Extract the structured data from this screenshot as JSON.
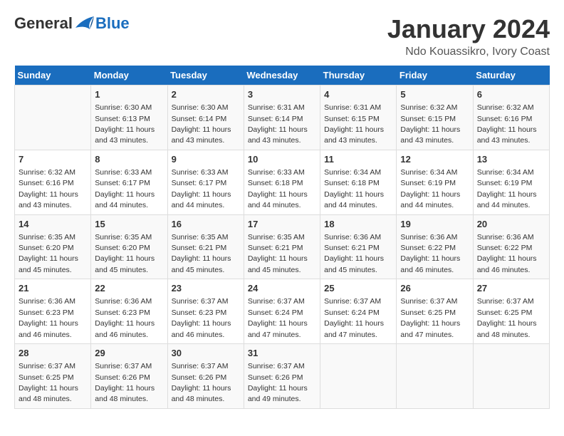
{
  "header": {
    "logo_general": "General",
    "logo_blue": "Blue",
    "title": "January 2024",
    "location": "Ndo Kouassikro, Ivory Coast"
  },
  "days_of_week": [
    "Sunday",
    "Monday",
    "Tuesday",
    "Wednesday",
    "Thursday",
    "Friday",
    "Saturday"
  ],
  "weeks": [
    [
      {
        "day": "",
        "info": ""
      },
      {
        "day": "1",
        "info": "Sunrise: 6:30 AM\nSunset: 6:13 PM\nDaylight: 11 hours\nand 43 minutes."
      },
      {
        "day": "2",
        "info": "Sunrise: 6:30 AM\nSunset: 6:14 PM\nDaylight: 11 hours\nand 43 minutes."
      },
      {
        "day": "3",
        "info": "Sunrise: 6:31 AM\nSunset: 6:14 PM\nDaylight: 11 hours\nand 43 minutes."
      },
      {
        "day": "4",
        "info": "Sunrise: 6:31 AM\nSunset: 6:15 PM\nDaylight: 11 hours\nand 43 minutes."
      },
      {
        "day": "5",
        "info": "Sunrise: 6:32 AM\nSunset: 6:15 PM\nDaylight: 11 hours\nand 43 minutes."
      },
      {
        "day": "6",
        "info": "Sunrise: 6:32 AM\nSunset: 6:16 PM\nDaylight: 11 hours\nand 43 minutes."
      }
    ],
    [
      {
        "day": "7",
        "info": "Sunrise: 6:32 AM\nSunset: 6:16 PM\nDaylight: 11 hours\nand 43 minutes."
      },
      {
        "day": "8",
        "info": "Sunrise: 6:33 AM\nSunset: 6:17 PM\nDaylight: 11 hours\nand 44 minutes."
      },
      {
        "day": "9",
        "info": "Sunrise: 6:33 AM\nSunset: 6:17 PM\nDaylight: 11 hours\nand 44 minutes."
      },
      {
        "day": "10",
        "info": "Sunrise: 6:33 AM\nSunset: 6:18 PM\nDaylight: 11 hours\nand 44 minutes."
      },
      {
        "day": "11",
        "info": "Sunrise: 6:34 AM\nSunset: 6:18 PM\nDaylight: 11 hours\nand 44 minutes."
      },
      {
        "day": "12",
        "info": "Sunrise: 6:34 AM\nSunset: 6:19 PM\nDaylight: 11 hours\nand 44 minutes."
      },
      {
        "day": "13",
        "info": "Sunrise: 6:34 AM\nSunset: 6:19 PM\nDaylight: 11 hours\nand 44 minutes."
      }
    ],
    [
      {
        "day": "14",
        "info": "Sunrise: 6:35 AM\nSunset: 6:20 PM\nDaylight: 11 hours\nand 45 minutes."
      },
      {
        "day": "15",
        "info": "Sunrise: 6:35 AM\nSunset: 6:20 PM\nDaylight: 11 hours\nand 45 minutes."
      },
      {
        "day": "16",
        "info": "Sunrise: 6:35 AM\nSunset: 6:21 PM\nDaylight: 11 hours\nand 45 minutes."
      },
      {
        "day": "17",
        "info": "Sunrise: 6:35 AM\nSunset: 6:21 PM\nDaylight: 11 hours\nand 45 minutes."
      },
      {
        "day": "18",
        "info": "Sunrise: 6:36 AM\nSunset: 6:21 PM\nDaylight: 11 hours\nand 45 minutes."
      },
      {
        "day": "19",
        "info": "Sunrise: 6:36 AM\nSunset: 6:22 PM\nDaylight: 11 hours\nand 46 minutes."
      },
      {
        "day": "20",
        "info": "Sunrise: 6:36 AM\nSunset: 6:22 PM\nDaylight: 11 hours\nand 46 minutes."
      }
    ],
    [
      {
        "day": "21",
        "info": "Sunrise: 6:36 AM\nSunset: 6:23 PM\nDaylight: 11 hours\nand 46 minutes."
      },
      {
        "day": "22",
        "info": "Sunrise: 6:36 AM\nSunset: 6:23 PM\nDaylight: 11 hours\nand 46 minutes."
      },
      {
        "day": "23",
        "info": "Sunrise: 6:37 AM\nSunset: 6:23 PM\nDaylight: 11 hours\nand 46 minutes."
      },
      {
        "day": "24",
        "info": "Sunrise: 6:37 AM\nSunset: 6:24 PM\nDaylight: 11 hours\nand 47 minutes."
      },
      {
        "day": "25",
        "info": "Sunrise: 6:37 AM\nSunset: 6:24 PM\nDaylight: 11 hours\nand 47 minutes."
      },
      {
        "day": "26",
        "info": "Sunrise: 6:37 AM\nSunset: 6:25 PM\nDaylight: 11 hours\nand 47 minutes."
      },
      {
        "day": "27",
        "info": "Sunrise: 6:37 AM\nSunset: 6:25 PM\nDaylight: 11 hours\nand 48 minutes."
      }
    ],
    [
      {
        "day": "28",
        "info": "Sunrise: 6:37 AM\nSunset: 6:25 PM\nDaylight: 11 hours\nand 48 minutes."
      },
      {
        "day": "29",
        "info": "Sunrise: 6:37 AM\nSunset: 6:26 PM\nDaylight: 11 hours\nand 48 minutes."
      },
      {
        "day": "30",
        "info": "Sunrise: 6:37 AM\nSunset: 6:26 PM\nDaylight: 11 hours\nand 48 minutes."
      },
      {
        "day": "31",
        "info": "Sunrise: 6:37 AM\nSunset: 6:26 PM\nDaylight: 11 hours\nand 49 minutes."
      },
      {
        "day": "",
        "info": ""
      },
      {
        "day": "",
        "info": ""
      },
      {
        "day": "",
        "info": ""
      }
    ]
  ]
}
